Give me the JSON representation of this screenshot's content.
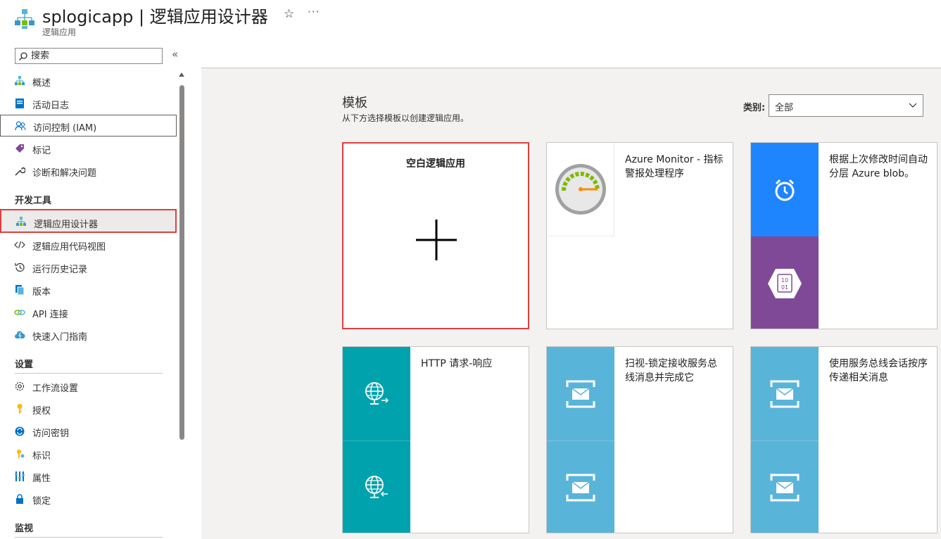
{
  "header": {
    "title": "splogicapp | 逻辑应用设计器",
    "subtitle": "逻辑应用",
    "favorite_icon": "star-icon",
    "more_icon": "more-icon",
    "more_glyph": "···",
    "star_glyph": "☆"
  },
  "sidebar": {
    "search_placeholder": "搜索",
    "collapse_glyph": "«",
    "items_top": [
      {
        "label": "概述",
        "icon": "overview-icon"
      },
      {
        "label": "活动日志",
        "icon": "activity-log-icon"
      },
      {
        "label": "访问控制 (IAM)",
        "icon": "iam-icon"
      },
      {
        "label": "标记",
        "icon": "tag-icon"
      },
      {
        "label": "诊断和解决问题",
        "icon": "wrench-icon"
      }
    ],
    "section_dev": "开发工具",
    "items_dev": [
      {
        "label": "逻辑应用设计器",
        "icon": "designer-icon"
      },
      {
        "label": "逻辑应用代码视图",
        "icon": "code-icon"
      },
      {
        "label": "运行历史记录",
        "icon": "history-icon"
      },
      {
        "label": "版本",
        "icon": "versions-icon"
      },
      {
        "label": "API 连接",
        "icon": "api-connection-icon"
      },
      {
        "label": "快速入门指南",
        "icon": "quickstart-icon"
      }
    ],
    "section_settings": "设置",
    "items_settings": [
      {
        "label": "工作流设置",
        "icon": "gear-icon"
      },
      {
        "label": "授权",
        "icon": "key-icon"
      },
      {
        "label": "访问密钥",
        "icon": "access-keys-icon"
      },
      {
        "label": "标识",
        "icon": "identity-icon"
      },
      {
        "label": "属性",
        "icon": "properties-icon"
      },
      {
        "label": "锁定",
        "icon": "lock-icon"
      }
    ],
    "section_monitor": "监视"
  },
  "templates": {
    "title": "模板",
    "subtitle": "从下方选择模板以创建逻辑应用。",
    "category_label": "类别:",
    "category_value": "全部",
    "cards": [
      {
        "text": "空白逻辑应用"
      },
      {
        "text": "Azure Monitor - 指标警报处理程序"
      },
      {
        "text": "根据上次修改时间自动分层 Azure blob。",
        "blob_label": "10 01"
      },
      {
        "text": "HTTP 请求-响应"
      },
      {
        "text": "扫视-锁定接收服务总线消息并完成它"
      },
      {
        "text": "使用服务总线会话按序传递相关消息"
      }
    ]
  },
  "colors": {
    "accent_red": "#e03e3e",
    "teal": "#00a2ad",
    "sky": "#59b4d9",
    "blue": "#1f85ff",
    "purple": "#804998"
  }
}
